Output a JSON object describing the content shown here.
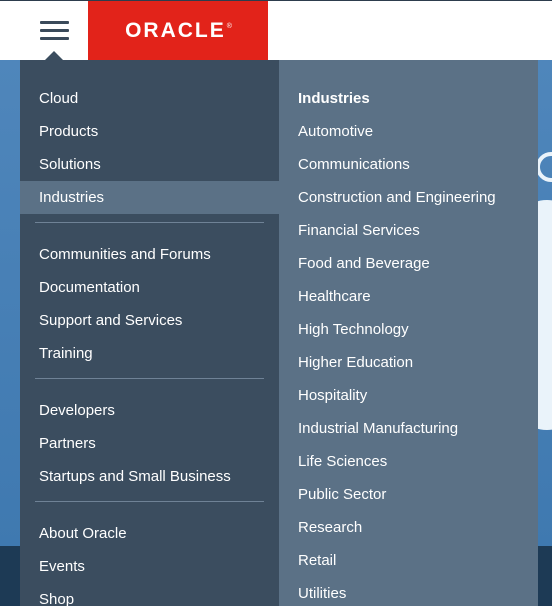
{
  "brand": {
    "logo_text": "ORACLE",
    "logo_mark": "®",
    "color": "#e2231a"
  },
  "menu": {
    "primary_groups": [
      [
        "Cloud",
        "Products",
        "Solutions",
        "Industries"
      ],
      [
        "Communities and Forums",
        "Documentation",
        "Support and Services",
        "Training"
      ],
      [
        "Developers",
        "Partners",
        "Startups and Small Business"
      ],
      [
        "About Oracle",
        "Events",
        "Shop"
      ]
    ],
    "active_item": "Industries",
    "submenu": {
      "heading": "Industries",
      "items": [
        "Automotive",
        "Communications",
        "Construction and Engineering",
        "Financial Services",
        "Food and Beverage",
        "Healthcare",
        "High Technology",
        "Higher Education",
        "Hospitality",
        "Industrial Manufacturing",
        "Life Sciences",
        "Public Sector",
        "Research",
        "Retail",
        "Utilities"
      ]
    }
  },
  "icons": {
    "menu": "hamburger-menu-icon"
  },
  "colors": {
    "menu_left_bg": "#3b4d5f",
    "menu_right_bg": "#5b7186",
    "active_bg": "#5b7186"
  }
}
